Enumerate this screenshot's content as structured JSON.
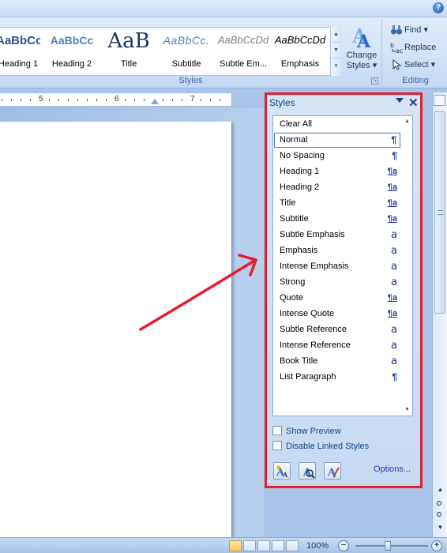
{
  "ribbon": {
    "help_icon": "help-icon",
    "styles_gallery": [
      {
        "preview": "AaBbCc",
        "name": "Heading 1"
      },
      {
        "preview": "AaBbCc",
        "name": "Heading 2"
      },
      {
        "preview": "AaB",
        "name": "Title"
      },
      {
        "preview": "AaBbCc.",
        "name": "Subtitle"
      },
      {
        "preview": "AaBbCcDd",
        "name": "Subtle Em..."
      },
      {
        "preview": "AaBbCcDd",
        "name": "Emphasis"
      }
    ],
    "change_styles": {
      "line1": "Change",
      "line2": "Styles ▾"
    },
    "styles_group_label": "Styles",
    "editing": {
      "find": "Find ▾",
      "replace": "Replace",
      "select": "Select ▾",
      "group_label": "Editing"
    }
  },
  "ruler": {
    "labels": [
      "5",
      "6",
      "7"
    ]
  },
  "styles_pane": {
    "title": "Styles",
    "items": [
      {
        "label": "Clear All",
        "type": ""
      },
      {
        "label": "Normal",
        "type": "¶",
        "selected": true
      },
      {
        "label": "No Spacing",
        "type": "¶"
      },
      {
        "label": "Heading 1",
        "type": "¶a"
      },
      {
        "label": "Heading 2",
        "type": "¶a"
      },
      {
        "label": "Title",
        "type": "¶a"
      },
      {
        "label": "Subtitle",
        "type": "¶a"
      },
      {
        "label": "Subtle Emphasis",
        "type": "a"
      },
      {
        "label": "Emphasis",
        "type": "a"
      },
      {
        "label": "Intense Emphasis",
        "type": "a"
      },
      {
        "label": "Strong",
        "type": "a"
      },
      {
        "label": "Quote",
        "type": "¶a"
      },
      {
        "label": "Intense Quote",
        "type": "¶a"
      },
      {
        "label": "Subtle Reference",
        "type": "a"
      },
      {
        "label": "Intense Reference",
        "type": "a"
      },
      {
        "label": "Book Title",
        "type": "a"
      },
      {
        "label": "List Paragraph",
        "type": "¶"
      }
    ],
    "show_preview": "Show Preview",
    "disable_linked": "Disable Linked Styles",
    "options": "Options...",
    "highlight_color": "#e31d2d"
  },
  "statusbar": {
    "zoom": "100%"
  },
  "colors": {
    "annotation_red": "#e31d2d",
    "ribbon_blue": "#d5e4f7",
    "accent_link": "#1e3faa"
  }
}
